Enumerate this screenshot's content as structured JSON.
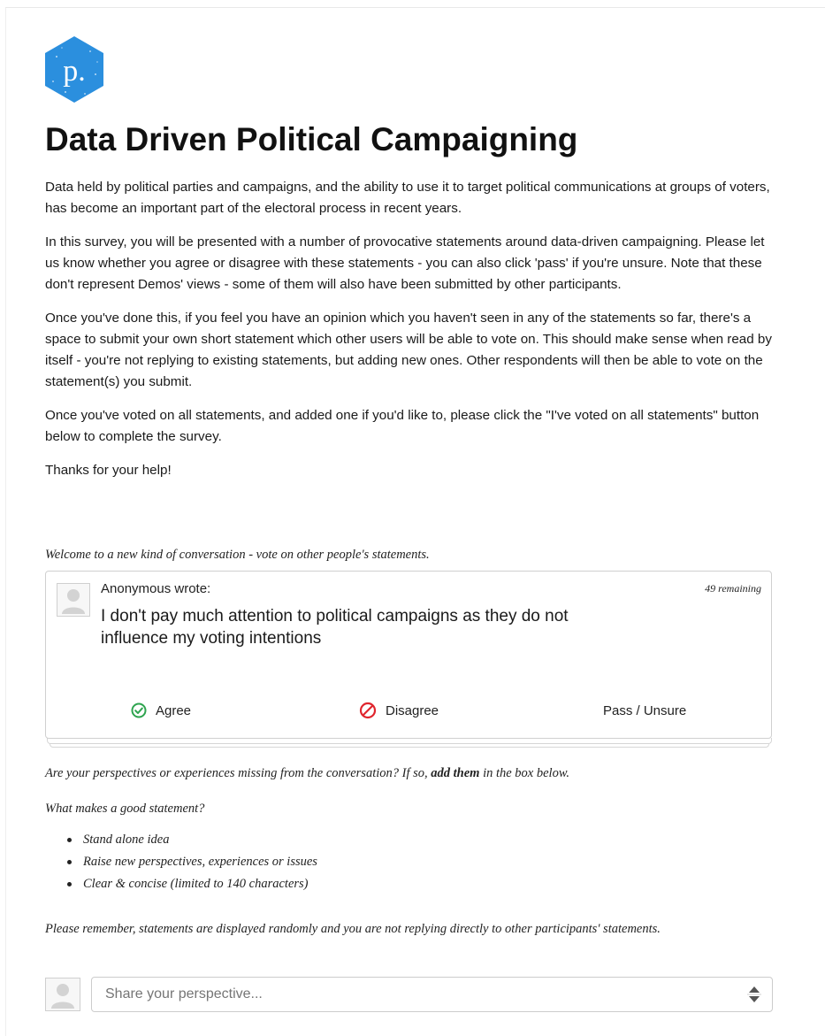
{
  "survey": {
    "title": "Data Driven Political Campaigning",
    "logo_letter": "p.",
    "logo_color": "#2b8fde",
    "paragraphs": [
      "Data held by political parties and campaigns, and the ability to use it to target political communications at groups of voters, has become an important part of the electoral process in recent years.",
      "In this survey, you will be presented with a number of provocative statements around data-driven campaigning. Please let us know whether you agree or disagree with these statements - you can also click 'pass' if you're unsure. Note that these don't represent Demos' views - some of them will also have been submitted by other participants.",
      "Once you've done this, if you feel you have an opinion which you haven't seen in any of the statements so far, there's a space to submit your own short statement which other users will be able to vote on. This should make sense when read by itself - you're not replying to existing statements, but adding new ones. Other respondents will then be able to vote on the statement(s) you submit.",
      "Once you've voted on all statements, and added one if you'd like to, please click the \"I've voted on all statements\" button below to complete the survey.",
      "Thanks for your help!"
    ]
  },
  "conversation": {
    "welcome": "Welcome to a new kind of conversation - vote on other people's statements.",
    "card": {
      "author": "Anonymous wrote:",
      "remaining": "49 remaining",
      "statement": "I don't pay much attention to political campaigns as they do not influence my voting intentions",
      "agree_label": "Agree",
      "disagree_label": "Disagree",
      "pass_label": "Pass / Unsure",
      "agree_color": "#2ea44f",
      "disagree_color": "#e0262e"
    }
  },
  "guidance": {
    "missing_prefix": "Are your perspectives or experiences missing from the conversation? If so, ",
    "missing_bold": "add them",
    "missing_suffix": " in the box below.",
    "good_statement_question": "What makes a good statement?",
    "tips": [
      "Stand alone idea",
      "Raise new perspectives, experiences or issues",
      "Clear & concise (limited to 140 characters)"
    ],
    "remember": "Please remember, statements are displayed randomly and you are not replying directly to other participants' statements."
  },
  "composer": {
    "placeholder": "Share your perspective..."
  }
}
